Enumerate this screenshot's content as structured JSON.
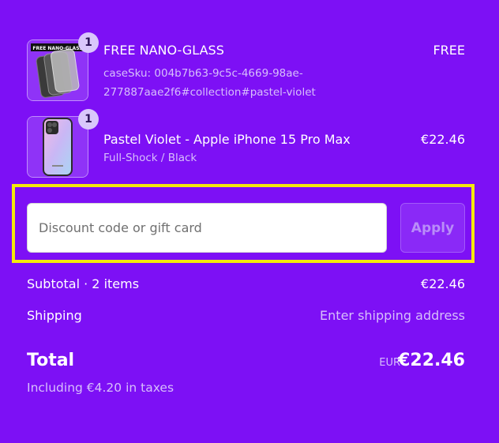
{
  "items": [
    {
      "name": "FREE NANO-GLASS",
      "detail_lines": [
        "caseSku: 004b7b63-9c5c-4669-98ae-",
        "277887aae2f6#collection#pastel-violet"
      ],
      "price": "FREE",
      "quantity": "1",
      "thumb_text": "FREE NANO-GLASS"
    },
    {
      "name": "Pastel Violet - Apple iPhone 15 Pro Max",
      "variant": "Full-Shock / Black",
      "price": "€22.46",
      "quantity": "1"
    }
  ],
  "discount": {
    "placeholder": "Discount code or gift card",
    "value": "",
    "apply_label": "Apply"
  },
  "summary": {
    "subtotal_label": "Subtotal · 2 items",
    "subtotal_value": "€22.46",
    "shipping_label": "Shipping",
    "shipping_value": "Enter shipping address",
    "total_label": "Total",
    "total_currency": "EUR",
    "total_value": "€22.46",
    "taxes_note": "Including €4.20 in taxes"
  },
  "colors": {
    "background": "#7d10f5",
    "highlight_frame": "#f5e90a",
    "muted_text": "#d7bffb"
  }
}
